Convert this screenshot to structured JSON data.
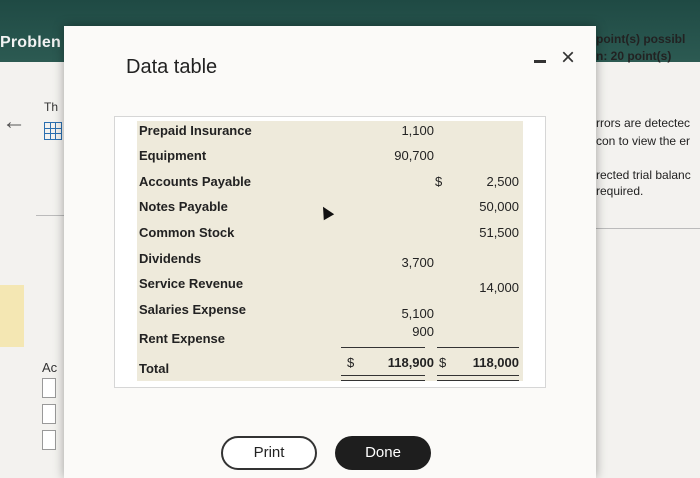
{
  "app": {
    "problem_label": "Problen"
  },
  "left_panel": {
    "th_label": "Th",
    "ac_label": "Ac"
  },
  "right_panel": {
    "points_line1": "point(s) possibl",
    "points_line2": "n: 20 point(s)",
    "errors_line1": "rrors are detectec",
    "errors_line2": "con to view the er",
    "trial_line1": "rected trial balanc",
    "trial_line2": "required."
  },
  "dialog": {
    "title": "Data table",
    "minimize_label": "-",
    "close_label": "×",
    "print_label": "Print",
    "done_label": "Done"
  },
  "table": {
    "rows": [
      {
        "account": "Prepaid Insurance",
        "debit": "1,100",
        "credit": ""
      },
      {
        "account": "Equipment",
        "debit": "90,700",
        "credit": ""
      },
      {
        "account": "Accounts Payable",
        "debit": "",
        "credit_sign": "$",
        "credit": "2,500"
      },
      {
        "account": "Notes Payable",
        "debit": "",
        "credit": "50,000"
      },
      {
        "account": "Common Stock",
        "debit": "",
        "credit": "51,500"
      },
      {
        "account": "Dividends",
        "debit": "3,700",
        "credit": ""
      },
      {
        "account": "Service Revenue",
        "debit": "",
        "credit": "14,000"
      },
      {
        "account": "Salaries Expense",
        "debit": "5,100",
        "credit": ""
      },
      {
        "account": "Rent Expense",
        "debit": "900",
        "credit": ""
      },
      {
        "account": "Total",
        "debit_sign": "$",
        "debit": "118,900",
        "credit_sign": "$",
        "credit": "118,000"
      }
    ]
  }
}
